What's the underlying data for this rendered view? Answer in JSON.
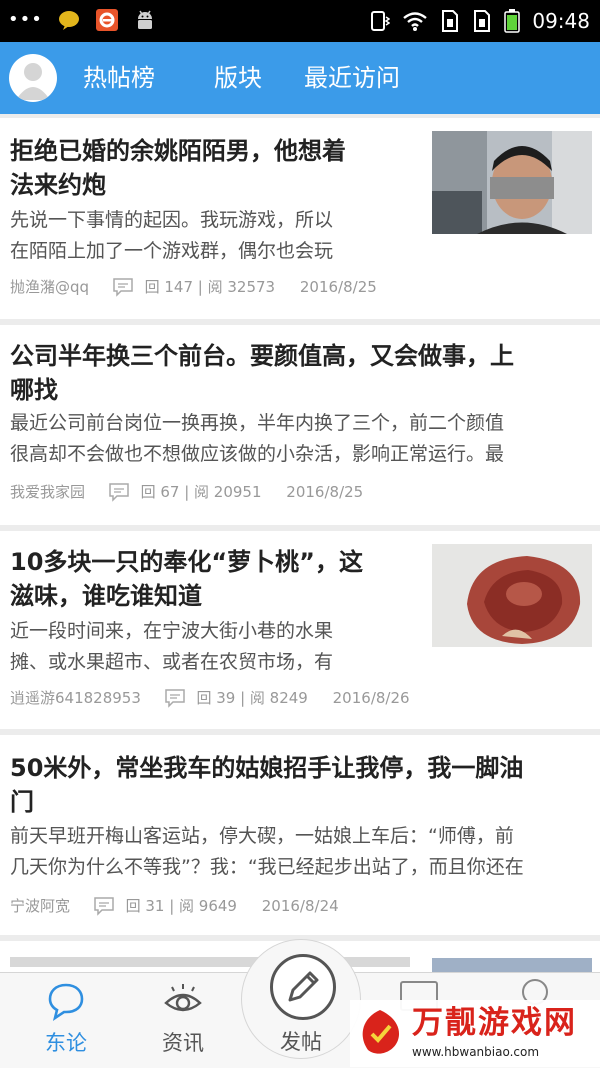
{
  "status_bar": {
    "time": "09:48"
  },
  "header": {
    "tabs": [
      {
        "label": "热帖榜"
      },
      {
        "label": "版块"
      },
      {
        "label": "最近访问"
      }
    ]
  },
  "posts": [
    {
      "title": "拒绝已婚的余姚陌陌男，他想着法来约炮",
      "title_lines": [
        "拒绝已婚的余姚陌陌男，他想着",
        "法来约炮"
      ],
      "excerpt_lines": [
        "先说一下事情的起因。我玩游戏，所以",
        "在陌陌上加了一个游戏群，偶尔也会玩"
      ],
      "author": "抛渔潴@qq",
      "stats": "回 147 | 阅 32573",
      "date": "2016/8/25",
      "has_thumb": true
    },
    {
      "title": "公司半年换三个前台。要颜值高，又会做事，上哪找",
      "title_lines": [
        "公司半年换三个前台。要颜值高，又会做事，上",
        "哪找"
      ],
      "excerpt_lines": [
        "最近公司前台岗位一换再换，半年内换了三个，前二个颜值",
        "很高却不会做也不想做应该做的小杂活，影响正常运行。最"
      ],
      "author": "我爱我家园",
      "stats": "回 67 | 阅 20951",
      "date": "2016/8/25",
      "has_thumb": false
    },
    {
      "title": "10多块一只的奉化“萝卜桃”，这滋味，谁吃谁知道",
      "title_lines": [
        "10多块一只的奉化“萝卜桃”，这",
        "滋味，谁吃谁知道"
      ],
      "excerpt_lines": [
        "近一段时间来，在宁波大街小巷的水果",
        "摊、或水果超市、或者在农贸市场，有"
      ],
      "author": "逍遥游641828953",
      "stats": "回 39 | 阅 8249",
      "date": "2016/8/26",
      "has_thumb": true
    },
    {
      "title": "50米外，常坐我车的姑娘招手让我停，我一脚油门",
      "title_lines": [
        "50米外，常坐我车的姑娘招手让我停，我一脚油",
        "门"
      ],
      "excerpt_lines": [
        "前天早班开梅山客运站，停大碶，一姑娘上车后：“师傅，前",
        "几天你为什么不等我”？我：“我已经起步出站了，而且你还在"
      ],
      "author": "宁波阿宽",
      "stats": "回 31 | 阅 9649",
      "date": "2016/8/24",
      "has_thumb": false
    }
  ],
  "bottom_nav": {
    "tabs": [
      {
        "label": "东论",
        "icon": "chat-bubble-icon",
        "active": true
      },
      {
        "label": "资讯",
        "icon": "eye-icon",
        "active": false
      },
      {
        "label": "发帖",
        "icon": "pencil-icon",
        "active": false
      }
    ]
  },
  "watermark": {
    "text": "万靓游戏网",
    "url": "www.hbwanbiao.com"
  },
  "colors": {
    "accent": "#3b9be9",
    "active_tab": "#2f8fe0",
    "inactive_tab": "#555555"
  }
}
